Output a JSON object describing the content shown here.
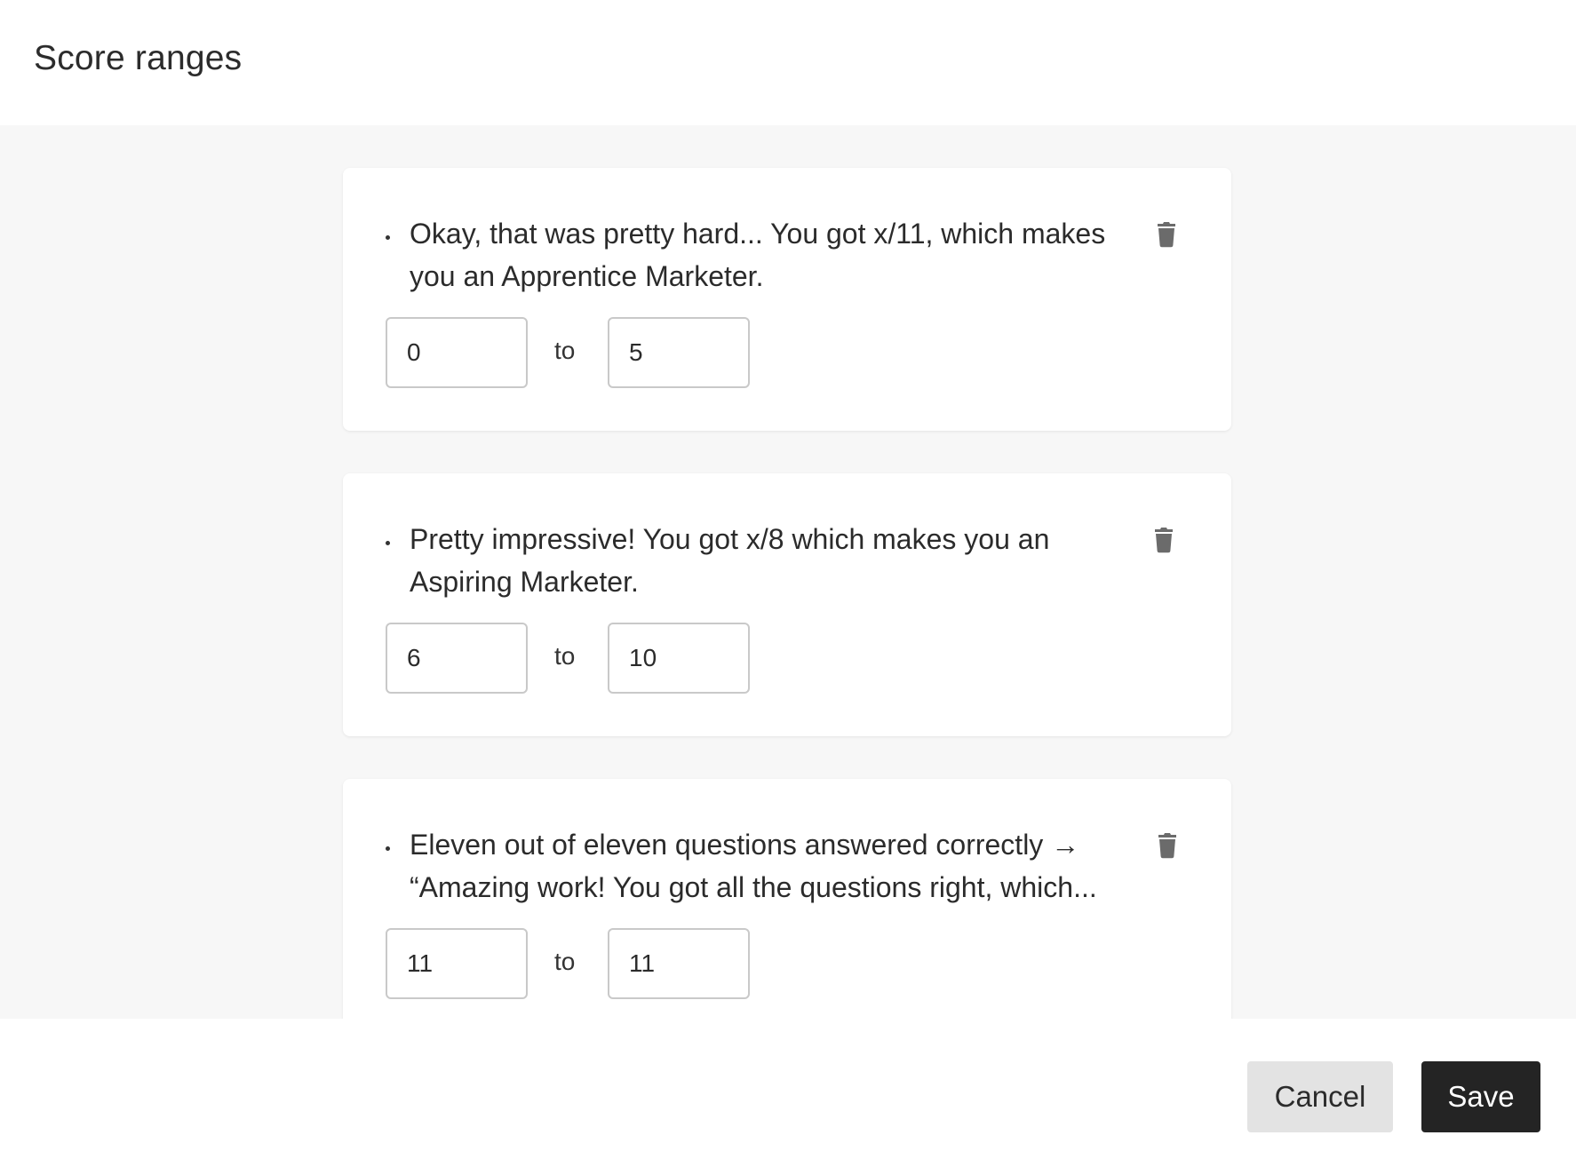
{
  "header": {
    "title": "Score ranges"
  },
  "ranges": [
    {
      "text": "Okay, that was pretty hard... You got x/11, which makes you an Apprentice Marketer.",
      "from": "0",
      "to": "5",
      "separator": "to"
    },
    {
      "text": "Pretty impressive! You got x/8 which makes you an Aspiring Marketer.",
      "from": "6",
      "to": "10",
      "separator": "to"
    },
    {
      "text": "Eleven out of eleven questions answered correctly → “Amazing work! You got all the questions right, which...",
      "from": "11",
      "to": "11",
      "separator": "to"
    }
  ],
  "footer": {
    "cancel_label": "Cancel",
    "save_label": "Save"
  },
  "colors": {
    "save_bg": "#242424",
    "cancel_bg": "#e3e3e3",
    "content_bg": "#f7f7f7",
    "icon": "#6b6b6b"
  },
  "icons": {
    "delete": "trash-icon"
  }
}
